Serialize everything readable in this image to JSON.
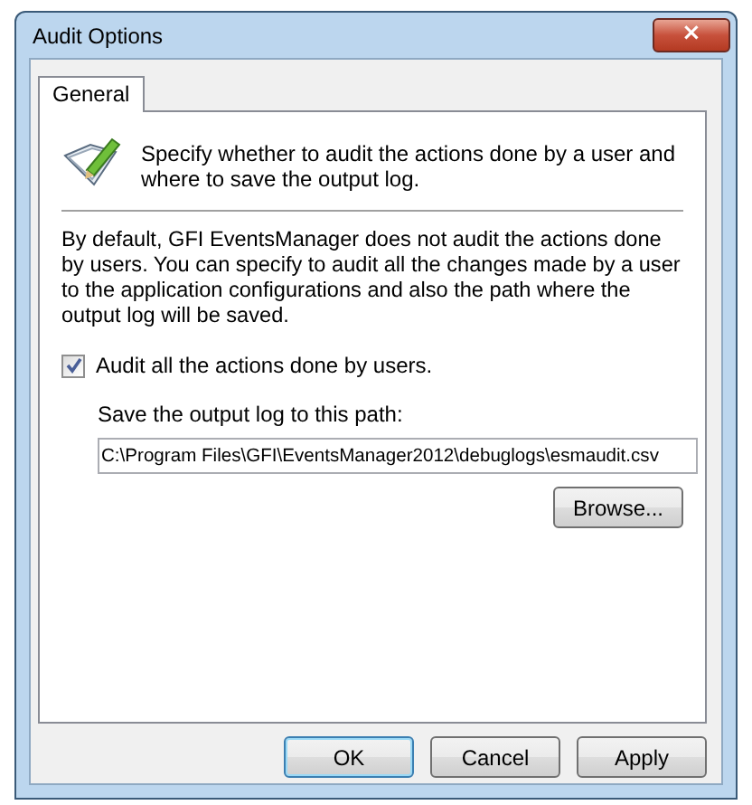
{
  "window": {
    "title": "Audit Options",
    "close": "×"
  },
  "tabs": [
    {
      "label": "General",
      "selected": true
    }
  ],
  "header": {
    "text": "Specify whether to audit the actions done by a user and where to save the output log."
  },
  "description": "By default, GFI EventsManager does not audit the actions done by users. You can specify to audit all the changes made by a user to the application configurations and also the path where the output log will be saved.",
  "audit_checkbox": {
    "label": "Audit all the actions done by users.",
    "checked": true
  },
  "path": {
    "label": "Save the output log to this path:",
    "value": "C:\\Program Files\\GFI\\EventsManager2012\\debuglogs\\esmaudit.csv",
    "browse": "Browse..."
  },
  "buttons": [
    {
      "label": "OK",
      "default": true
    },
    {
      "label": "Cancel",
      "default": false
    },
    {
      "label": "Apply",
      "default": false
    }
  ]
}
